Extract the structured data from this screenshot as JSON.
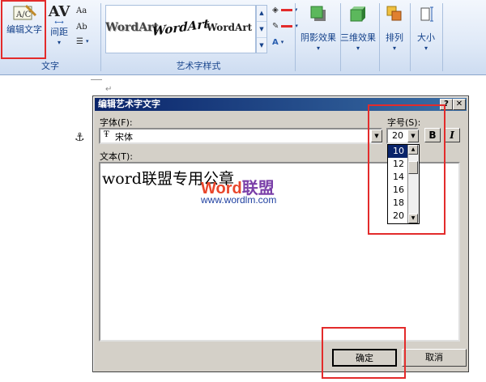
{
  "ribbon": {
    "text_group": {
      "label": "文字",
      "edit_text": "编辑文字",
      "spacing": "间距"
    },
    "wordart_styles": {
      "label": "艺术字样式",
      "samples": [
        "WordArt",
        "WordArt",
        "WordArt"
      ]
    },
    "shadow_effects": "阴影效果",
    "three_d_effects": "三维效果",
    "arrange": "排列",
    "size": "大小"
  },
  "dialog": {
    "title": "编辑艺术字文字",
    "font_label": "字体(F):",
    "font_value": "宋体",
    "size_label": "字号(S):",
    "size_value": "20",
    "bold": "B",
    "italic": "I",
    "text_label": "文本(T):",
    "text_value": "word联盟专用公章",
    "ok": "确定",
    "cancel": "取消",
    "size_options": [
      "10",
      "12",
      "14",
      "16",
      "18",
      "20"
    ],
    "selected_size": "10"
  },
  "watermark": {
    "brand_word": "Word",
    "brand_cn": "联盟",
    "url": "www.wordlm.com"
  },
  "colors": {
    "highlight_border": "#e32b2b",
    "title_bar": "#0a246a",
    "selection": "#0a246a",
    "ribbon_text": "#15428b"
  }
}
